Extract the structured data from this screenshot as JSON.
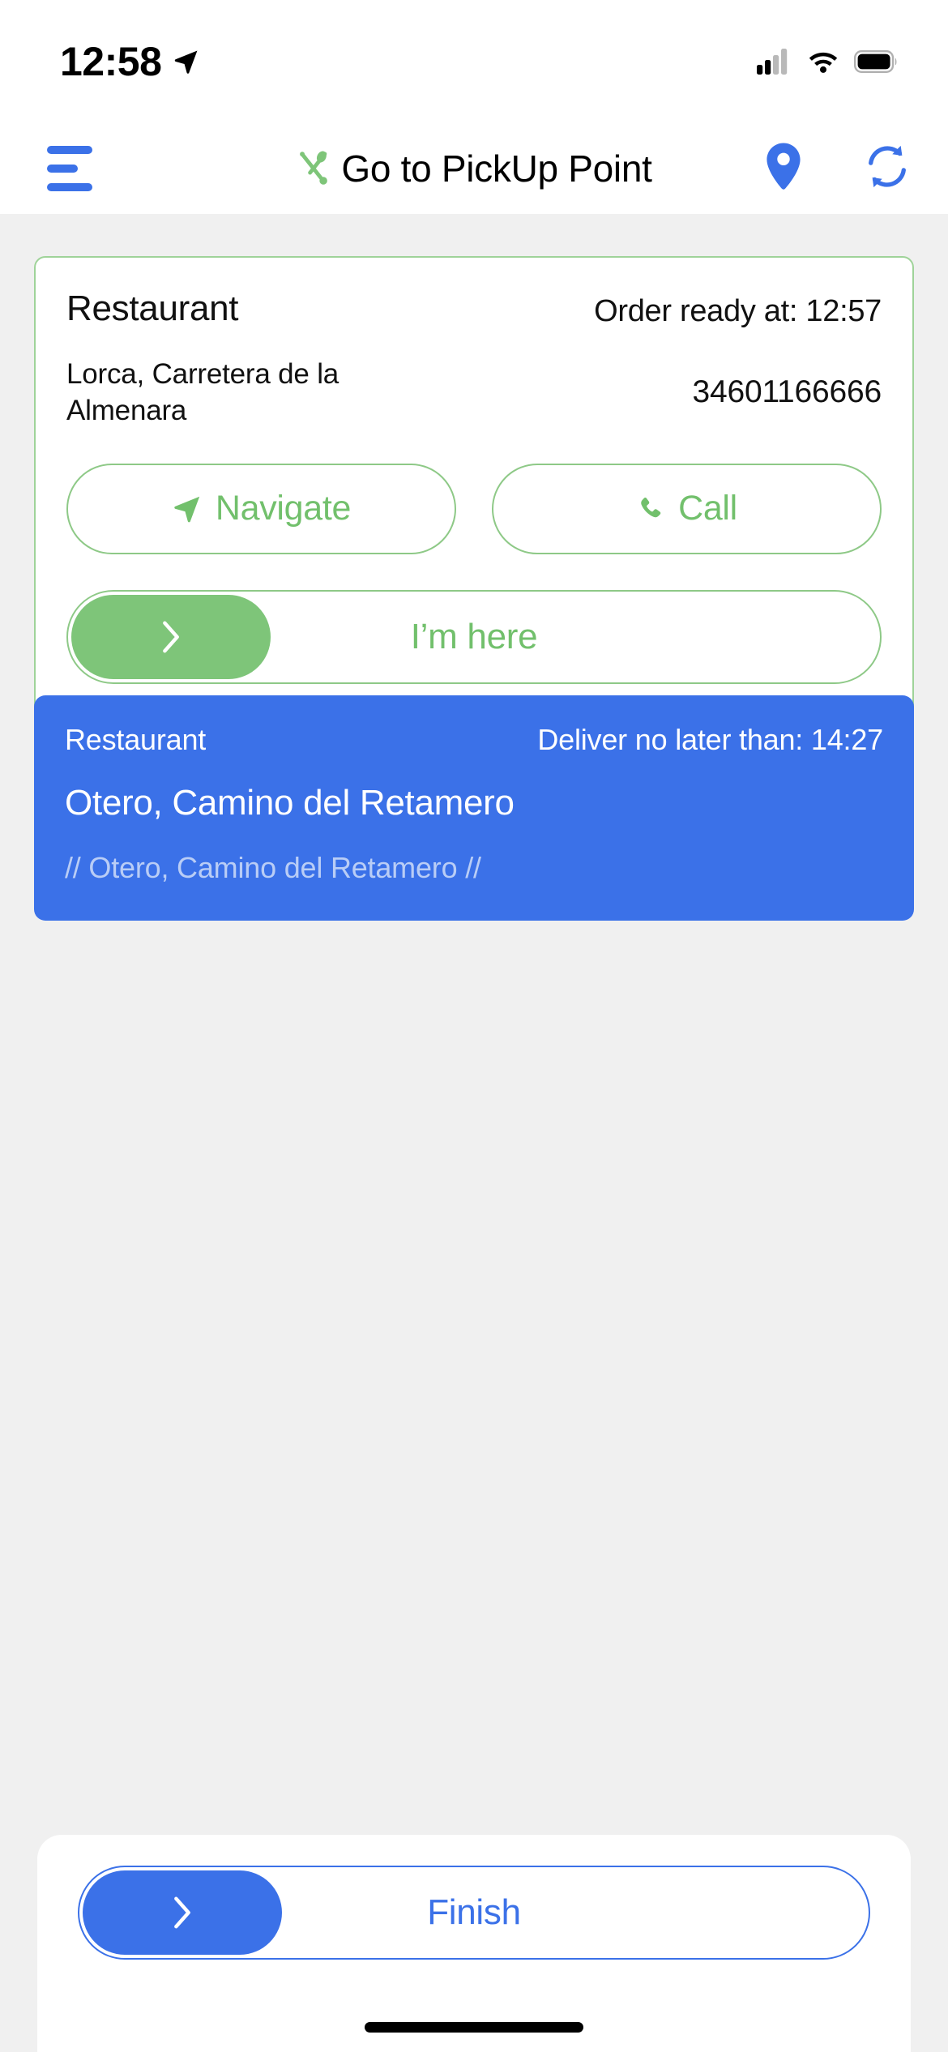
{
  "status_bar": {
    "time": "12:58",
    "location_arrow_icon": "location-arrow-icon",
    "cellular_icon": "cellular-signal-icon",
    "wifi_icon": "wifi-icon",
    "battery_icon": "battery-icon"
  },
  "nav": {
    "menu_icon": "hamburger-menu-icon",
    "brand_icon": "fork-spoon-icon",
    "title": "Go to PickUp Point",
    "map_icon": "map-pin-icon",
    "refresh_icon": "sync-refresh-icon",
    "accent_blue": "#3b71e8",
    "accent_green": "#7ec579"
  },
  "pickup_card": {
    "label": "Restaurant",
    "ready_at": "Order ready at: 12:57",
    "address": "Lorca, Carretera de la Almenara",
    "phone": "34601166666",
    "navigate_label": "Navigate",
    "navigate_icon": "navigate-arrow-icon",
    "call_label": "Call",
    "call_icon": "phone-handset-icon",
    "slider_label": "I’m here",
    "slider_icon": "chevron-right-icon",
    "border_color": "#9fd399"
  },
  "delivery_card": {
    "label": "Restaurant",
    "deliver_by": "Deliver no later than: 14:27",
    "address": "Otero, Camino del Retamero",
    "note": "// Otero, Camino del Retamero //",
    "background_color": "#3b71e8"
  },
  "bottom_sheet": {
    "finish_label": "Finish",
    "finish_icon": "chevron-right-icon",
    "home_indicator": "home-indicator"
  }
}
